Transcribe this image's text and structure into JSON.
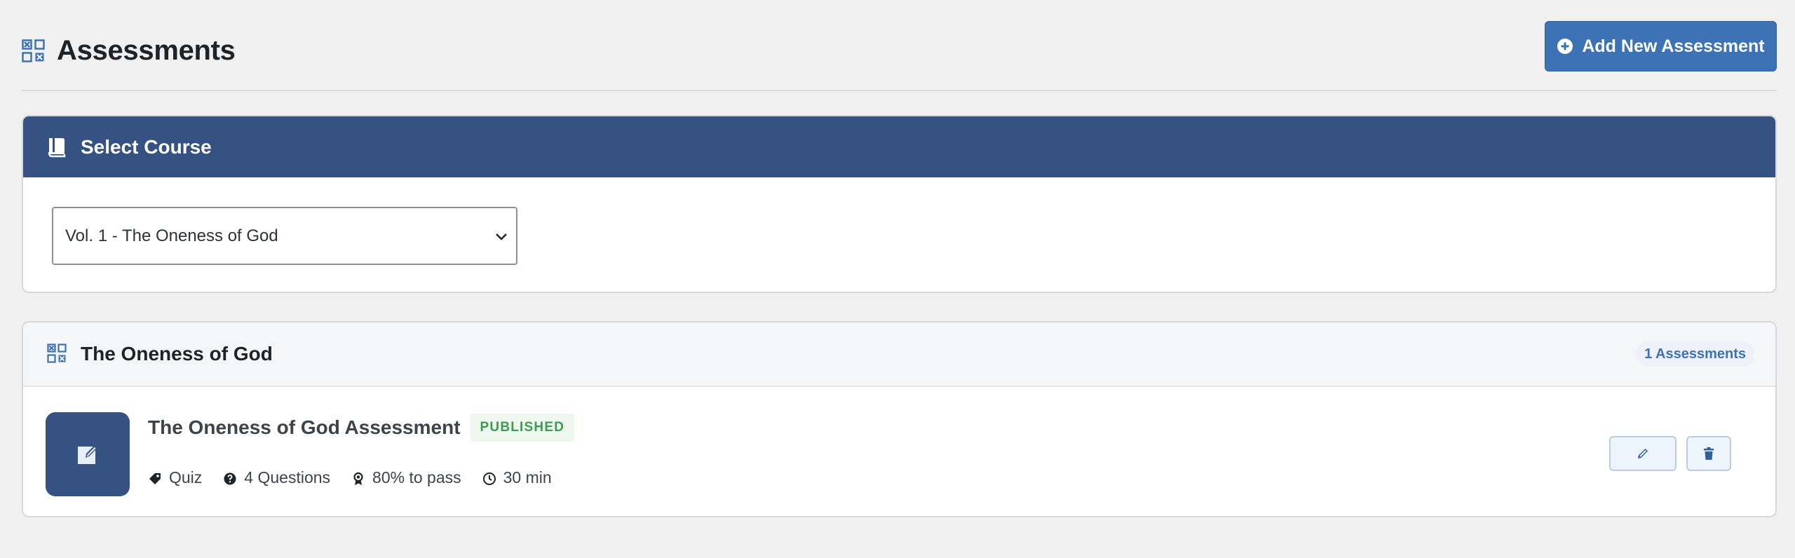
{
  "header": {
    "title": "Assessments",
    "title_icon": "grid-icon",
    "add_button_label": "Add New Assessment",
    "add_button_icon": "plus-circle-icon"
  },
  "course_selector": {
    "title": "Select Course",
    "icon": "book-icon",
    "selected_value": "Vol. 1 - The Oneness of God"
  },
  "assessment_list": {
    "title": "The Oneness of God",
    "icon": "grid-icon",
    "count_label": "1 Assessments",
    "items": [
      {
        "title": "The Oneness of God Assessment",
        "status": "PUBLISHED",
        "thumb_icon": "edit-note-icon",
        "meta": {
          "type": "Quiz",
          "questions": "4 Questions",
          "pass": "80% to pass",
          "duration": "30 min"
        }
      }
    ]
  },
  "colors": {
    "primary": "#3d72b4",
    "header_dark": "#355282",
    "background": "#f0f0f1",
    "published_green": "#3d9a50"
  }
}
